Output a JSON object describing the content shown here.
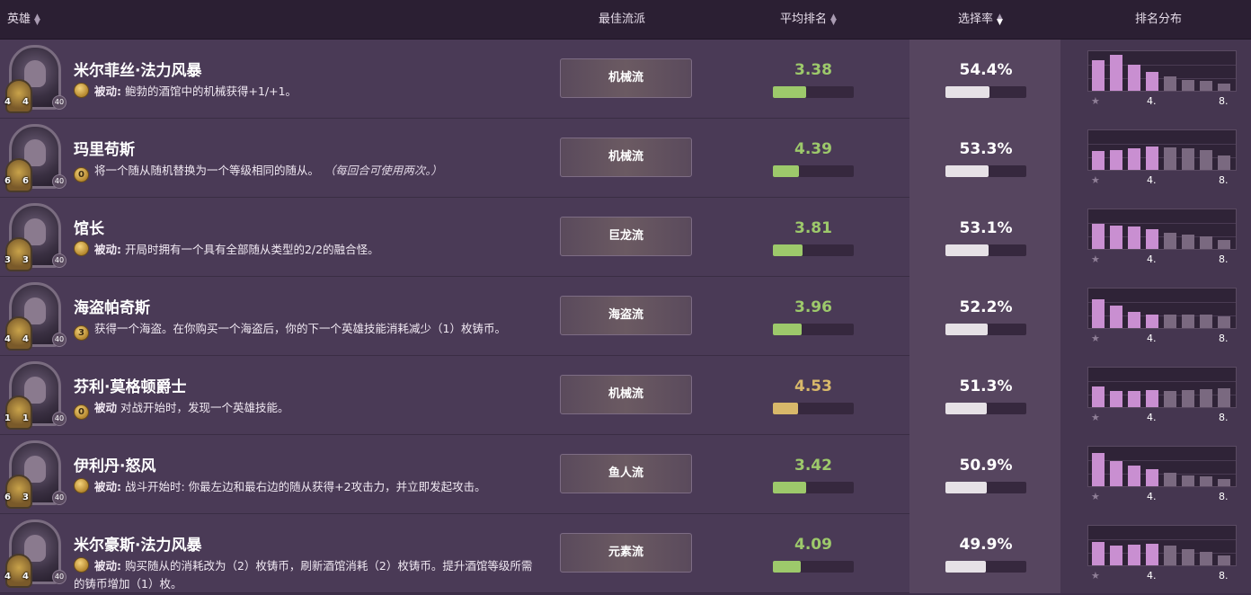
{
  "header": {
    "hero": "英雄",
    "best_build": "最佳流派",
    "avg_rank": "平均排名",
    "pick_rate": "选择率",
    "rank_dist": "排名分布"
  },
  "dist_labels": {
    "star": "★",
    "mid": "4.",
    "end": "8."
  },
  "colors": {
    "good": "#9dc96b",
    "mid": "#d8b86a",
    "bar_top": "#c98fd1",
    "bar_bottom": "#7a6980"
  },
  "heroes": [
    {
      "name": "米尔菲丝·法力风暴",
      "cost": "",
      "desc_keyword": "被动:",
      "desc_text": " 鲍勃的酒馆中的机械获得+1/+1。",
      "note": "",
      "attack": "4",
      "health": "4",
      "armor": "40",
      "build": "机械流",
      "avg_rank": "3.38",
      "avg_value": 3.38,
      "avg_color": "good",
      "pick_rate": "54.4%",
      "pick_value": 54.4,
      "dist": [
        0.78,
        0.9,
        0.66,
        0.48,
        0.36,
        0.28,
        0.24,
        0.18
      ]
    },
    {
      "name": "玛里苟斯",
      "cost": "0",
      "desc_keyword": "",
      "desc_text": "将一个随从随机替换为一个等级相同的随从。",
      "note": "（每回合可使用两次。）",
      "attack": "6",
      "health": "6",
      "armor": "40",
      "build": "机械流",
      "avg_rank": "4.39",
      "avg_value": 4.39,
      "avg_color": "good",
      "pick_rate": "53.3%",
      "pick_value": 53.3,
      "dist": [
        0.48,
        0.5,
        0.55,
        0.58,
        0.56,
        0.54,
        0.5,
        0.36
      ]
    },
    {
      "name": "馆长",
      "cost": "",
      "desc_keyword": "被动:",
      "desc_text": " 开局时拥有一个具有全部随从类型的2/2的融合怪。",
      "note": "",
      "attack": "3",
      "health": "3",
      "armor": "40",
      "build": "巨龙流",
      "avg_rank": "3.81",
      "avg_value": 3.81,
      "avg_color": "good",
      "pick_rate": "53.1%",
      "pick_value": 53.1,
      "dist": [
        0.64,
        0.6,
        0.56,
        0.5,
        0.42,
        0.36,
        0.32,
        0.22
      ]
    },
    {
      "name": "海盗帕奇斯",
      "cost": "3",
      "desc_keyword": "",
      "desc_text": "获得一个海盗。在你购买一个海盗后，你的下一个英雄技能消耗减少（1）枚铸币。",
      "note": "",
      "attack": "4",
      "health": "4",
      "armor": "40",
      "build": "海盗流",
      "avg_rank": "3.96",
      "avg_value": 3.96,
      "avg_color": "good",
      "pick_rate": "52.2%",
      "pick_value": 52.2,
      "dist": [
        0.72,
        0.56,
        0.42,
        0.34,
        0.34,
        0.34,
        0.34,
        0.3
      ]
    },
    {
      "name": "芬利·莫格顿爵士",
      "cost": "0",
      "desc_keyword": "被动",
      "desc_text": " 对战开始时，发现一个英雄技能。",
      "note": "",
      "attack": "1",
      "health": "1",
      "armor": "40",
      "build": "机械流",
      "avg_rank": "4.53",
      "avg_value": 4.53,
      "avg_color": "mid",
      "pick_rate": "51.3%",
      "pick_value": 51.3,
      "dist": [
        0.52,
        0.42,
        0.4,
        0.44,
        0.42,
        0.44,
        0.46,
        0.48
      ]
    },
    {
      "name": "伊利丹·怒风",
      "cost": "",
      "desc_keyword": "被动:",
      "desc_text": " 战斗开始时: 你最左边和最右边的随从获得+2攻击力，并立即发起攻击。",
      "note": "",
      "attack": "6",
      "health": "3",
      "armor": "40",
      "build": "鱼人流",
      "avg_rank": "3.42",
      "avg_value": 3.42,
      "avg_color": "good",
      "pick_rate": "50.9%",
      "pick_value": 50.9,
      "dist": [
        0.84,
        0.64,
        0.52,
        0.44,
        0.34,
        0.28,
        0.24,
        0.18
      ]
    },
    {
      "name": "米尔豪斯·法力风暴",
      "cost": "",
      "desc_keyword": "被动:",
      "desc_text": " 购买随从的消耗改为（2）枚铸币，刷新酒馆消耗（2）枚铸币。提升酒馆等级所需的铸币增加（1）枚。",
      "note": "",
      "attack": "4",
      "health": "4",
      "armor": "40",
      "build": "元素流",
      "avg_rank": "4.09",
      "avg_value": 4.09,
      "avg_color": "good",
      "pick_rate": "49.9%",
      "pick_value": 49.9,
      "dist": [
        0.58,
        0.5,
        0.52,
        0.54,
        0.5,
        0.42,
        0.34,
        0.24
      ]
    }
  ]
}
